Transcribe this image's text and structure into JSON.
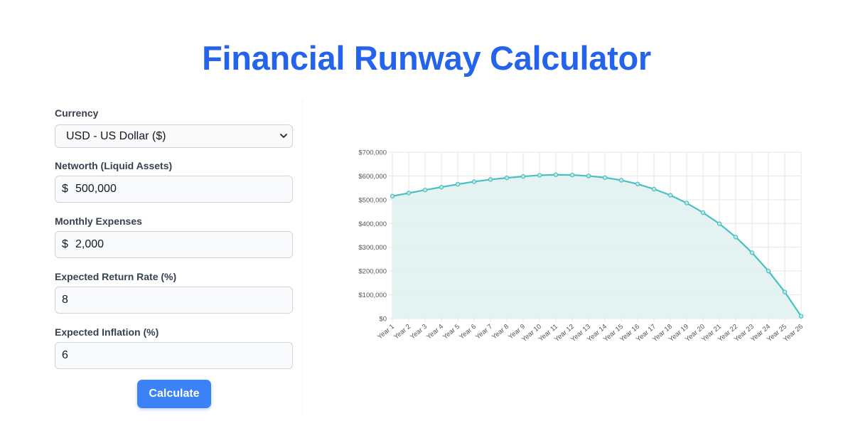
{
  "page": {
    "title": "Financial Runway Calculator"
  },
  "form": {
    "currency": {
      "label": "Currency",
      "value": "USD - US Dollar ($)"
    },
    "networth": {
      "label": "Networth (Liquid Assets)",
      "prefix": "$",
      "value": "500,000"
    },
    "expenses": {
      "label": "Monthly Expenses",
      "prefix": "$",
      "value": "2,000"
    },
    "return_rate": {
      "label": "Expected Return Rate (%)",
      "value": "8"
    },
    "inflation": {
      "label": "Expected Inflation (%)",
      "value": "6"
    },
    "calculate_label": "Calculate"
  },
  "colors": {
    "title": "#2463eb",
    "button": "#3b82f6",
    "line": "#4bc0c0",
    "fill": "#dff1ef"
  },
  "chart_data": {
    "type": "area",
    "title": "",
    "xlabel": "",
    "ylabel": "",
    "categories": [
      "Year 1",
      "Year 2",
      "Year 3",
      "Year 4",
      "Year 5",
      "Year 6",
      "Year 7",
      "Year 8",
      "Year 9",
      "Year 10",
      "Year 11",
      "Year 12",
      "Year 13",
      "Year 14",
      "Year 15",
      "Year 16",
      "Year 17",
      "Year 18",
      "Year 19",
      "Year 20",
      "Year 21",
      "Year 22",
      "Year 23",
      "Year 24",
      "Year 25",
      "Year 26"
    ],
    "values": [
      515000,
      528000,
      541000,
      553000,
      565000,
      576000,
      585000,
      592000,
      598000,
      603000,
      605000,
      604000,
      600000,
      593000,
      582000,
      566000,
      545000,
      519000,
      486000,
      446000,
      399000,
      343000,
      277000,
      200000,
      112000,
      10000
    ],
    "ylim": [
      0,
      700000
    ],
    "yticks": [
      0,
      100000,
      200000,
      300000,
      400000,
      500000,
      600000,
      700000
    ],
    "ytick_labels": [
      "$0",
      "$100,000",
      "$200,000",
      "$300,000",
      "$400,000",
      "$500,000",
      "$600,000",
      "$700,000"
    ],
    "grid": true,
    "legend": "none"
  }
}
